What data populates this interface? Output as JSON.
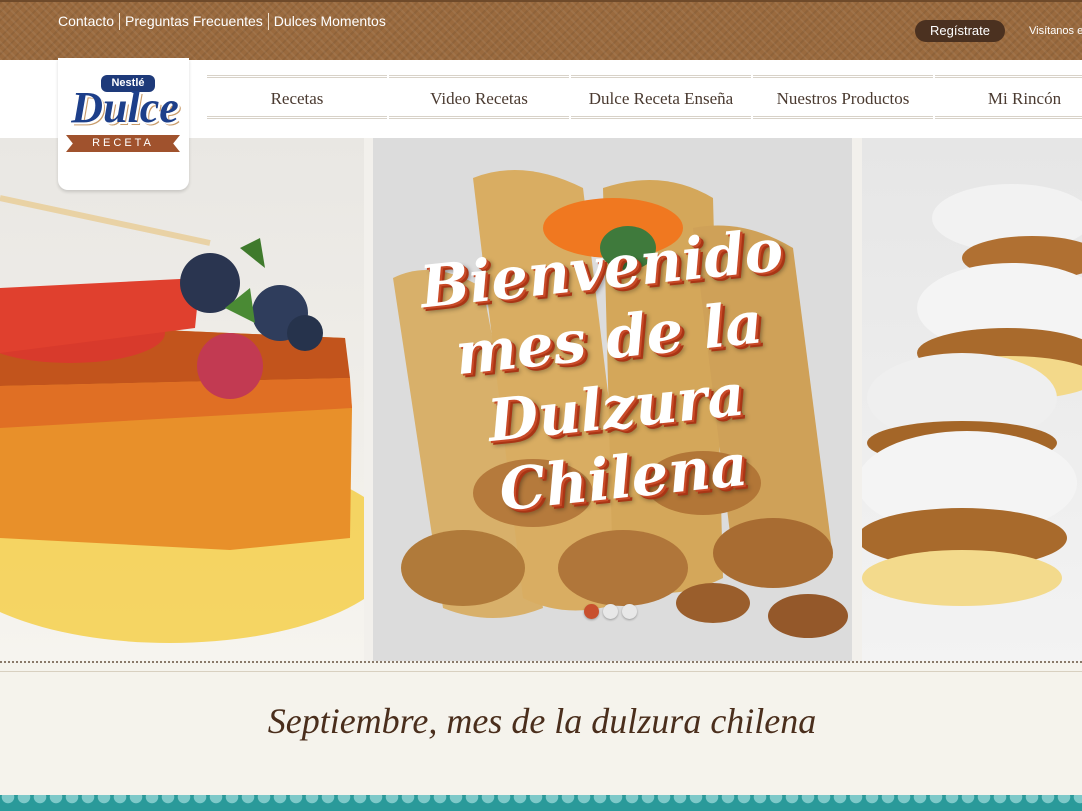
{
  "top_links": [
    "Contacto",
    "Preguntas Frecuentes",
    "Dulces Momentos"
  ],
  "register_label": "Regístrate",
  "visit_text": "Visítanos e",
  "logo": {
    "brand": "Nestlé",
    "name": "Dulce",
    "ribbon": "RECETA"
  },
  "nav": [
    "Recetas",
    "Video Recetas",
    "Dulce Receta Enseña",
    "Nuestros Productos",
    "Mi Rincón"
  ],
  "hero": {
    "welcome_lines": [
      "Bienvenido",
      "mes de la",
      "Dulzura Chilena"
    ],
    "slides_total": 3,
    "slide_active": 1
  },
  "headline": "Septiembre, mes de la dulzura chilena",
  "colors": {
    "topbar": "#9a6a3e",
    "register_bg": "#4b3120",
    "accent_orange": "#c8502e",
    "teal": "#2a9a9a",
    "headline": "#4a2e1c"
  }
}
